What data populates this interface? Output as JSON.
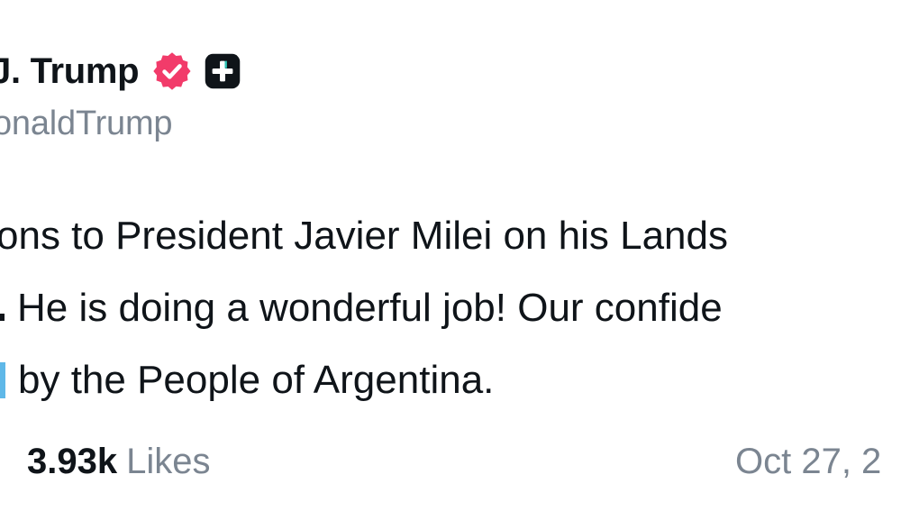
{
  "author": {
    "display_name": "J. Trump",
    "handle": "onaldTrump"
  },
  "post": {
    "line1": "ons to President Javier Milei on his Lands",
    "line2": "He is doing a wonderful job! Our confide",
    "line3": "by the People of Argentina."
  },
  "footer": {
    "likes_count": "3.93k",
    "likes_label": "Likes",
    "date": "Oct 27, 2"
  },
  "colors": {
    "verified_badge": "#f23b6a",
    "plus_badge": "#0f1419",
    "text_primary": "#0f1419",
    "text_secondary": "#7b8591",
    "link_accent": "#5fb8e8"
  },
  "icons": {
    "verified": "verified-badge-icon",
    "plus": "plus-badge-icon"
  }
}
